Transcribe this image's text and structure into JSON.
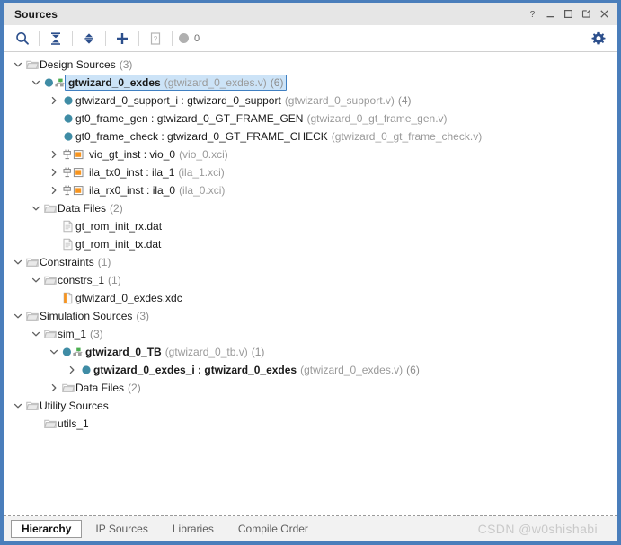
{
  "window": {
    "title": "Sources",
    "title_buttons": [
      {
        "name": "help-button",
        "glyph": "?"
      },
      {
        "name": "minimize-button",
        "glyph": "_"
      },
      {
        "name": "maximize-button",
        "glyph": "square"
      },
      {
        "name": "float-button",
        "glyph": "float"
      },
      {
        "name": "close-button",
        "glyph": "X"
      }
    ]
  },
  "toolbar": {
    "items": [
      {
        "name": "search-icon",
        "label": "Search"
      },
      {
        "name": "collapse-all-icon",
        "label": "Collapse All"
      },
      {
        "name": "expand-all-icon",
        "label": "Expand All"
      },
      {
        "name": "add-sources-icon",
        "label": "Add Sources"
      },
      {
        "name": "report-icon",
        "label": "Report",
        "disabled": true
      }
    ],
    "message_count": "0",
    "settings_label": "Settings"
  },
  "tree": {
    "rows": [
      {
        "indent": 0,
        "arrow": "down",
        "icon": "folder",
        "name": "Design Sources",
        "file": "",
        "count": "(3)",
        "bold": false,
        "selected": false,
        "dim_name": false
      },
      {
        "indent": 1,
        "arrow": "down",
        "icon": "module-top",
        "name": "gtwizard_0_exdes",
        "file": "(gtwizard_0_exdes.v)",
        "count": "(6)",
        "bold": true,
        "selected": true,
        "dim_name": false
      },
      {
        "indent": 2,
        "arrow": "right",
        "icon": "module",
        "name": "gtwizard_0_support_i : gtwizard_0_support",
        "file": "(gtwizard_0_support.v)",
        "count": "(4)",
        "bold": false,
        "selected": false,
        "dim_name": false
      },
      {
        "indent": 2,
        "arrow": "none",
        "icon": "module",
        "name": "gt0_frame_gen : gtwizard_0_GT_FRAME_GEN",
        "file": "(gtwizard_0_gt_frame_gen.v)",
        "count": "",
        "bold": false,
        "selected": false,
        "dim_name": false
      },
      {
        "indent": 2,
        "arrow": "none",
        "icon": "module",
        "name": "gt0_frame_check : gtwizard_0_GT_FRAME_CHECK",
        "file": "(gtwizard_0_gt_frame_check.v)",
        "count": "",
        "bold": false,
        "selected": false,
        "dim_name": false
      },
      {
        "indent": 2,
        "arrow": "right",
        "icon": "ip",
        "name": "vio_gt_inst : vio_0",
        "file": "(vio_0.xci)",
        "count": "",
        "bold": false,
        "selected": false,
        "dim_name": false
      },
      {
        "indent": 2,
        "arrow": "right",
        "icon": "ip",
        "name": "ila_tx0_inst : ila_1",
        "file": "(ila_1.xci)",
        "count": "",
        "bold": false,
        "selected": false,
        "dim_name": false
      },
      {
        "indent": 2,
        "arrow": "right",
        "icon": "ip",
        "name": "ila_rx0_inst : ila_0",
        "file": "(ila_0.xci)",
        "count": "",
        "bold": false,
        "selected": false,
        "dim_name": false
      },
      {
        "indent": 1,
        "arrow": "down",
        "icon": "folder",
        "name": "Data Files",
        "file": "",
        "count": "(2)",
        "bold": false,
        "selected": false,
        "dim_name": false
      },
      {
        "indent": 2,
        "arrow": "none",
        "icon": "datafile",
        "name": "gt_rom_init_rx.dat",
        "file": "",
        "count": "",
        "bold": false,
        "selected": false,
        "dim_name": false
      },
      {
        "indent": 2,
        "arrow": "none",
        "icon": "datafile",
        "name": "gt_rom_init_tx.dat",
        "file": "",
        "count": "",
        "bold": false,
        "selected": false,
        "dim_name": false
      },
      {
        "indent": 0,
        "arrow": "down",
        "icon": "folder",
        "name": "Constraints",
        "file": "",
        "count": "(1)",
        "bold": false,
        "selected": false,
        "dim_name": false
      },
      {
        "indent": 1,
        "arrow": "down",
        "icon": "folder",
        "name": "constrs_1",
        "file": "",
        "count": "(1)",
        "bold": false,
        "selected": false,
        "dim_name": false
      },
      {
        "indent": 2,
        "arrow": "none",
        "icon": "xdcfile",
        "name": "gtwizard_0_exdes.xdc",
        "file": "",
        "count": "",
        "bold": false,
        "selected": false,
        "dim_name": false
      },
      {
        "indent": 0,
        "arrow": "down",
        "icon": "folder",
        "name": "Simulation Sources",
        "file": "",
        "count": "(3)",
        "bold": false,
        "selected": false,
        "dim_name": false
      },
      {
        "indent": 1,
        "arrow": "down",
        "icon": "folder",
        "name": "sim_1",
        "file": "",
        "count": "(3)",
        "bold": false,
        "selected": false,
        "dim_name": false
      },
      {
        "indent": 2,
        "arrow": "down",
        "icon": "module-top",
        "name": "gtwizard_0_TB",
        "file": "(gtwizard_0_tb.v)",
        "count": "(1)",
        "bold": true,
        "selected": false,
        "dim_name": false
      },
      {
        "indent": 3,
        "arrow": "right",
        "icon": "module",
        "name": "gtwizard_0_exdes_i : gtwizard_0_exdes",
        "file": "(gtwizard_0_exdes.v)",
        "count": "(6)",
        "bold": true,
        "selected": false,
        "dim_name": false
      },
      {
        "indent": 2,
        "arrow": "right",
        "icon": "folder",
        "name": "Data Files",
        "file": "",
        "count": "(2)",
        "bold": false,
        "selected": false,
        "dim_name": false
      },
      {
        "indent": 0,
        "arrow": "down",
        "icon": "folder",
        "name": "Utility Sources",
        "file": "",
        "count": "",
        "bold": false,
        "selected": false,
        "dim_name": false
      },
      {
        "indent": 1,
        "arrow": "none",
        "icon": "folder",
        "name": "utils_1",
        "file": "",
        "count": "",
        "bold": false,
        "selected": false,
        "dim_name": false
      }
    ]
  },
  "bottom_tabs": {
    "tabs": [
      {
        "label": "Hierarchy",
        "active": true
      },
      {
        "label": "IP Sources",
        "active": false
      },
      {
        "label": "Libraries",
        "active": false
      },
      {
        "label": "Compile Order",
        "active": false
      }
    ],
    "watermark": "CSDN @w0shishabi"
  },
  "colors": {
    "accent_border": "#4a7ebb",
    "titlebar_bg": "#e6e6e6",
    "selection_bg": "#cce3f7",
    "selection_border": "#3f7fc1",
    "module_icon": "#3f8ca5",
    "ip_icon": "#f7941e",
    "toolbar_icon": "#2c4f8c"
  }
}
